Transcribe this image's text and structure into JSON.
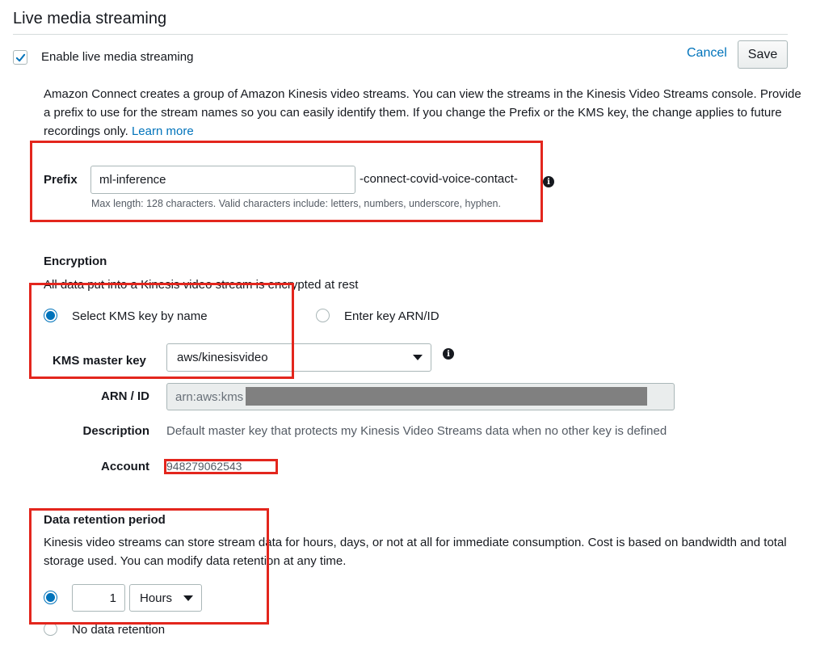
{
  "section": {
    "title": "Live media streaming"
  },
  "toggle": {
    "label": "Enable live media streaming",
    "checked": true
  },
  "actions": {
    "cancel_label": "Cancel",
    "save_label": "Save"
  },
  "intro": {
    "text": "Amazon Connect creates a group of Amazon Kinesis video streams. You can view the streams in the Kinesis Video Streams console. Provide a prefix to use for the stream names so you can easily identify them. If you change the Prefix or the KMS key, the change applies to future recordings only.",
    "learn_more": "Learn more"
  },
  "prefix": {
    "label": "Prefix",
    "value": "ml-inference",
    "suffix": "-connect-covid-voice-contact-",
    "hint": "Max length: 128 characters. Valid characters include: letters, numbers, underscore, hyphen.",
    "info_icon": "info-icon"
  },
  "encryption": {
    "heading": "Encryption",
    "subtext": "All data put into a Kinesis video stream is encrypted at rest",
    "option_by_name": "Select KMS key by name",
    "option_arn": "Enter key ARN/ID",
    "selected_option": "by_name",
    "kms_label": "KMS master key",
    "kms_value": "aws/kinesisvideo",
    "arn_label": "ARN / ID",
    "arn_value": "arn:aws:kms",
    "description_label": "Description",
    "description_value": "Default master key that protects my Kinesis Video Streams data when no other key is defined",
    "account_label": "Account",
    "account_value": "948279062543"
  },
  "retention": {
    "heading": "Data retention period",
    "text": "Kinesis video streams can store stream data for hours, days, or not at all for immediate consumption. Cost is based on bandwidth and total storage used. You can modify data retention at any time.",
    "amount": "1",
    "unit": "Hours",
    "no_retention_label": "No data retention",
    "selected_option": "amount"
  },
  "colors": {
    "accent": "#0073bb",
    "annotation": "#e3261d",
    "text": "#16191f"
  }
}
